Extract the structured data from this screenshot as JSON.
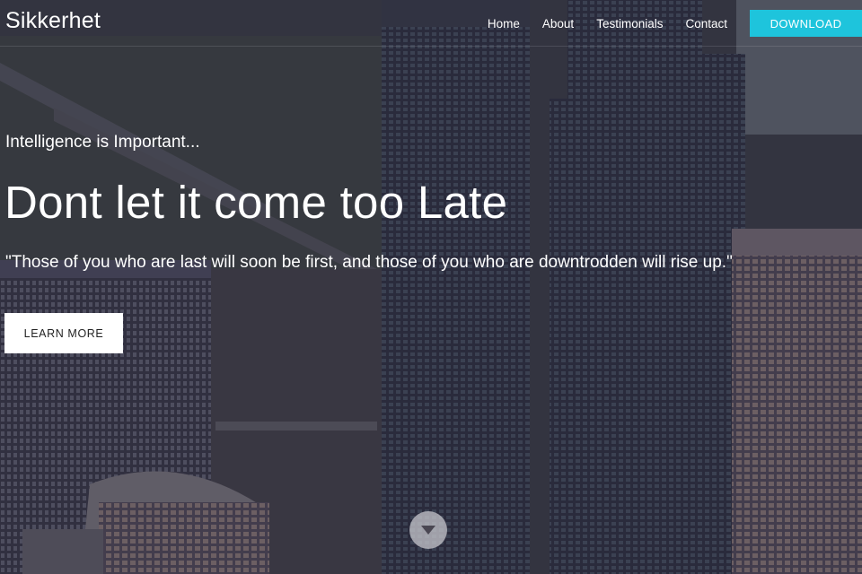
{
  "brand": {
    "name": "Sikkerhet"
  },
  "nav": {
    "links": [
      "Home",
      "About",
      "Testimonials",
      "Contact"
    ],
    "download_label": "DOWNLOAD"
  },
  "hero": {
    "eyebrow": "Intelligence is Important...",
    "headline": "Dont let it come too Late",
    "quote": "\"Those of you who are last will soon be first, and those of you who are downtrodden will rise up.\"",
    "cta_label": "LEARN MORE"
  },
  "colors": {
    "accent": "#1ec4dc",
    "cta_background": "#ffffff",
    "text": "#ffffff"
  },
  "icons": {
    "scroll_down": "chevron-down-icon"
  }
}
